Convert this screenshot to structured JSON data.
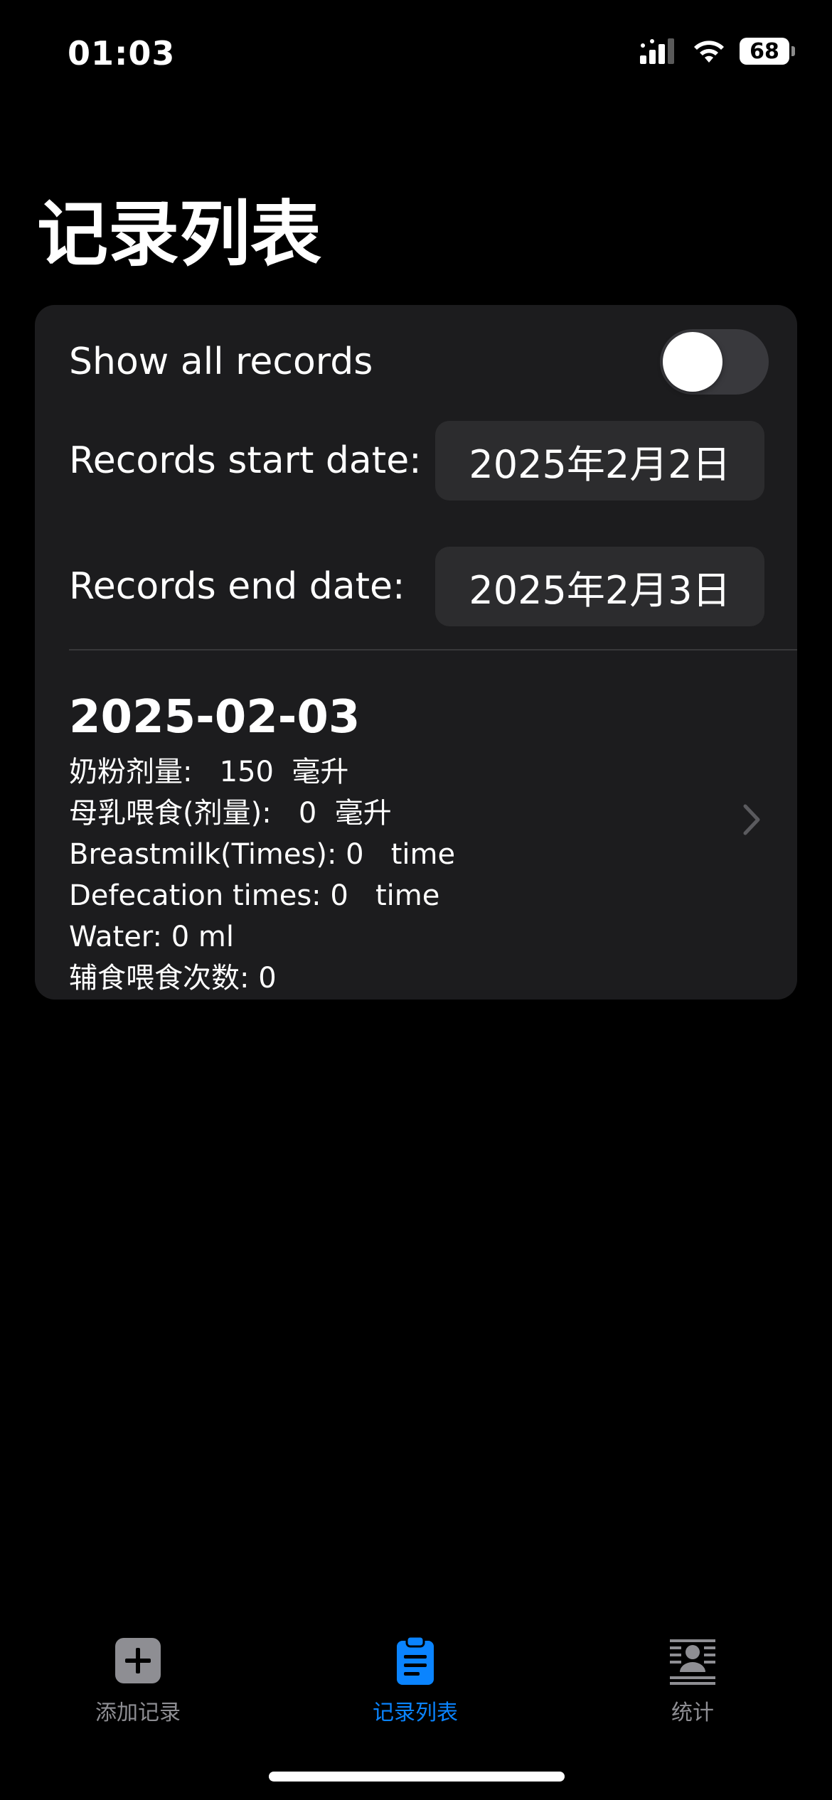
{
  "status_bar": {
    "time": "01:03",
    "battery": "68"
  },
  "header": {
    "title": "记录列表"
  },
  "filters": {
    "show_all_label": "Show all records",
    "show_all_on": false,
    "start_label": "Records start date:",
    "start_value": "2025年2月2日",
    "end_label": "Records end date:",
    "end_value": "2025年2月3日"
  },
  "records": [
    {
      "date": "2025-02-03",
      "lines": [
        "奶粉剂量:   150  毫升",
        "母乳喂食(剂量):   0  毫升",
        "Breastmilk(Times): 0   time",
        "Defecation times: 0   time",
        "Water: 0 ml",
        "辅食喂食次数: 0"
      ]
    }
  ],
  "tab_bar": {
    "tabs": [
      {
        "label": "添加记录",
        "icon": "plus-square-icon",
        "active": false
      },
      {
        "label": "记录列表",
        "icon": "clipboard-icon",
        "active": true
      },
      {
        "label": "统计",
        "icon": "person-text-icon",
        "active": false
      }
    ]
  },
  "colors": {
    "accent": "#0a84ff",
    "card_bg": "#1c1c1e",
    "pill_bg": "#2c2c2e",
    "inactive": "#8e8e93"
  }
}
